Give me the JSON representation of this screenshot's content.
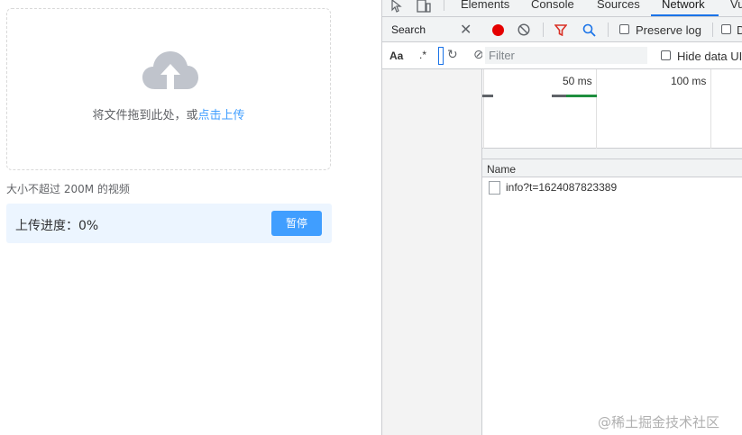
{
  "upload": {
    "drop_text": "将文件拖到此处，或",
    "drop_link": "点击上传",
    "tip": "大小不超过 200M 的视频",
    "progress_label": "上传进度：0%",
    "progress_value": 0,
    "pause_button": "暂停",
    "icon": "cloud-upload-icon",
    "accent_color": "#409eff"
  },
  "devtools": {
    "tabs": [
      "Elements",
      "Console",
      "Sources",
      "Network",
      "Vu"
    ],
    "active_tab": "Network",
    "search": {
      "title": "Search",
      "case_option": "Aa",
      "regex_option": ".*"
    },
    "network": {
      "preserve_log": "Preserve log",
      "filter_placeholder": "Filter",
      "hide_data_urls": "Hide data UI",
      "overview_labels": [
        "50 ms",
        "100 ms"
      ],
      "column_name": "Name",
      "requests": [
        {
          "name": "info?t=1624087823389"
        }
      ]
    }
  },
  "watermark": "@稀土掘金技术社区"
}
